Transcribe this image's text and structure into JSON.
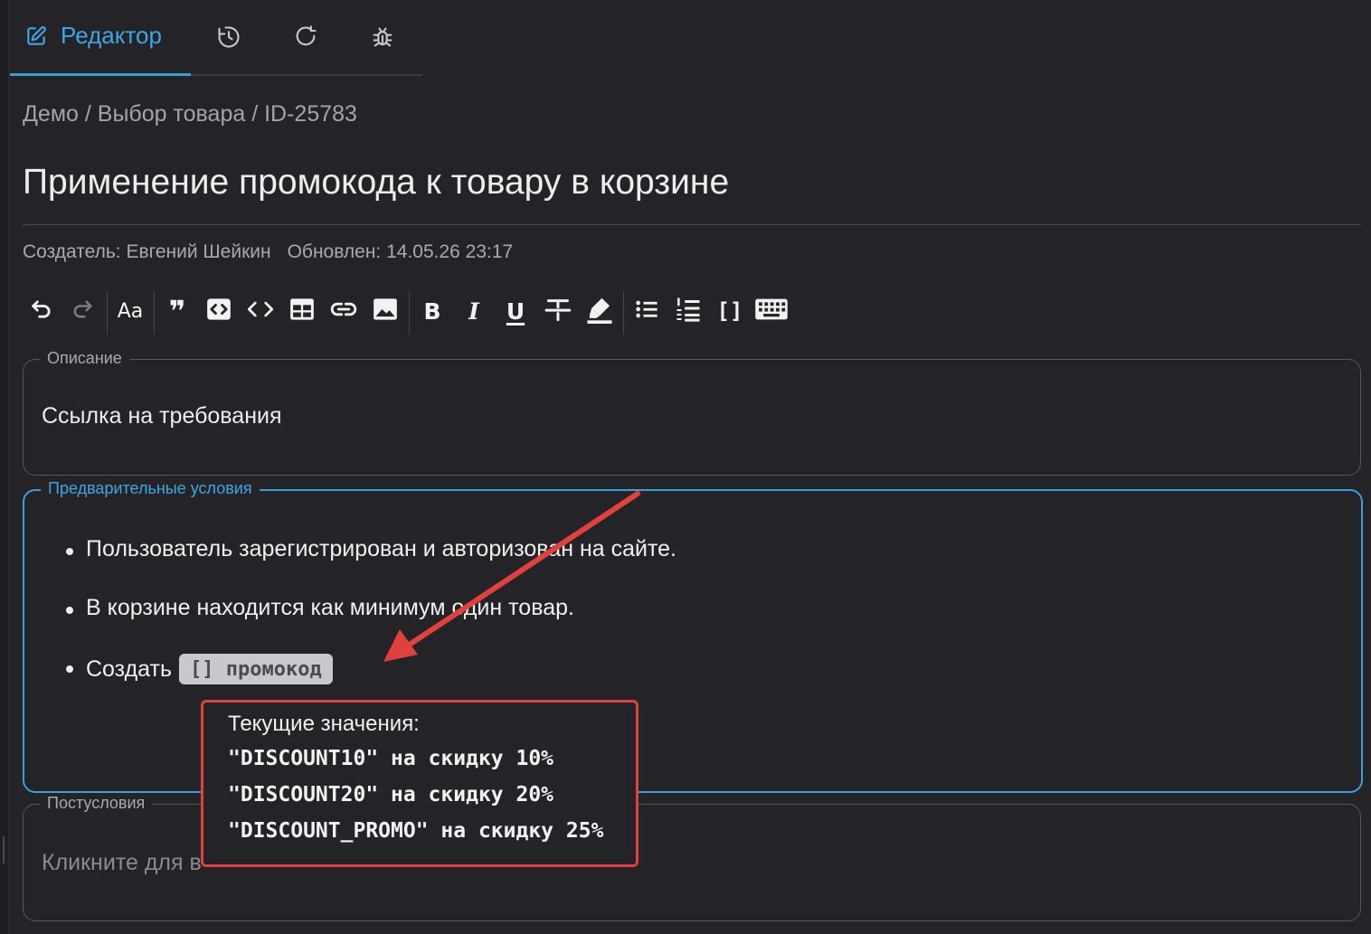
{
  "tabs": {
    "editor_label": "Редактор"
  },
  "breadcrumb": "Демо / Выбор товара / ID-25783",
  "title": "Применение промокода к товару в корзине",
  "meta": {
    "creator": "Создатель: Евгений Шейкин",
    "updated": "Обновлен: 14.05.26 23:17"
  },
  "toolbar": {
    "font_label": "Aa",
    "quote_label": "❞",
    "bold_label": "B",
    "italic_label": "I",
    "underline_label": "U",
    "placeholder_label": "[]"
  },
  "fields": {
    "description": {
      "legend": "Описание",
      "value": "Ссылка на требования"
    },
    "preconditions": {
      "legend": "Предварительные условия",
      "items": [
        "Пользователь зарегистрирован и авторизован на сайте.",
        "В корзине находится как минимум один товар.",
        "Создать"
      ],
      "chip_label": "[] промокод"
    },
    "postconditions": {
      "legend": "Постусловия",
      "placeholder": "Кликните для в"
    }
  },
  "popup": {
    "title": "Текущие значения:",
    "lines": [
      "\"DISCOUNT10\" на скидку 10%",
      "\"DISCOUNT20\" на скидку 20%",
      "\"DISCOUNT_PROMO\" на скидку 25%"
    ]
  },
  "colors": {
    "accent": "#3b9ed8",
    "annotation": "#e0413d",
    "background": "#242428"
  }
}
